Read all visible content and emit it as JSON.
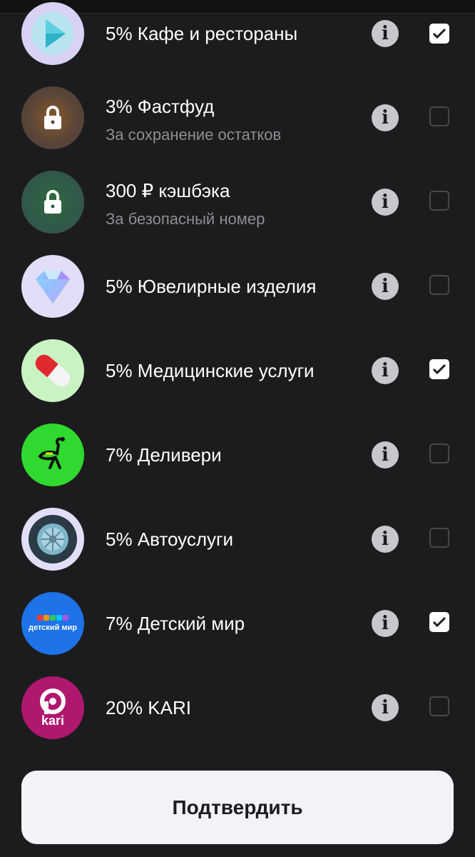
{
  "categories": [
    {
      "title": "5% Кафе и рестораны",
      "subtitle": "",
      "icon": "play-icon",
      "locked": false,
      "checked": true,
      "bg": "#d9d2f5"
    },
    {
      "title": "3% Фастфуд",
      "subtitle": "За сохранение остатков",
      "icon": "lock-icon",
      "locked": true,
      "checked": false,
      "bg": "#5a4538"
    },
    {
      "title": "300 ₽ кэшбэка",
      "subtitle": "За безопасный номер",
      "icon": "lock-icon",
      "locked": true,
      "checked": false,
      "bg": "#2f5a4a"
    },
    {
      "title": "5% Ювелирные изделия",
      "subtitle": "",
      "icon": "diamond-icon",
      "locked": false,
      "checked": false,
      "bg": "#e3def8"
    },
    {
      "title": "5% Медицинские услуги",
      "subtitle": "",
      "icon": "pill-icon",
      "locked": false,
      "checked": true,
      "bg": "#c9f3c2"
    },
    {
      "title": "7% Деливери",
      "subtitle": "",
      "icon": "ostrich-icon",
      "locked": false,
      "checked": false,
      "bg": "#2fd92f"
    },
    {
      "title": "5% Автоуслуги",
      "subtitle": "",
      "icon": "wheel-icon",
      "locked": false,
      "checked": false,
      "bg": "#e3def8"
    },
    {
      "title": "7% Детский мир",
      "subtitle": "",
      "icon": "detsky-mir-logo",
      "locked": false,
      "checked": true,
      "bg": "#1e73e8",
      "logo_text": "детский мир"
    },
    {
      "title": "20% KARI",
      "subtitle": "",
      "icon": "kari-logo",
      "locked": false,
      "checked": false,
      "bg": "#b0176e",
      "logo_text": "kari"
    }
  ],
  "info_glyph": "i",
  "confirm_label": "Подтвердить"
}
